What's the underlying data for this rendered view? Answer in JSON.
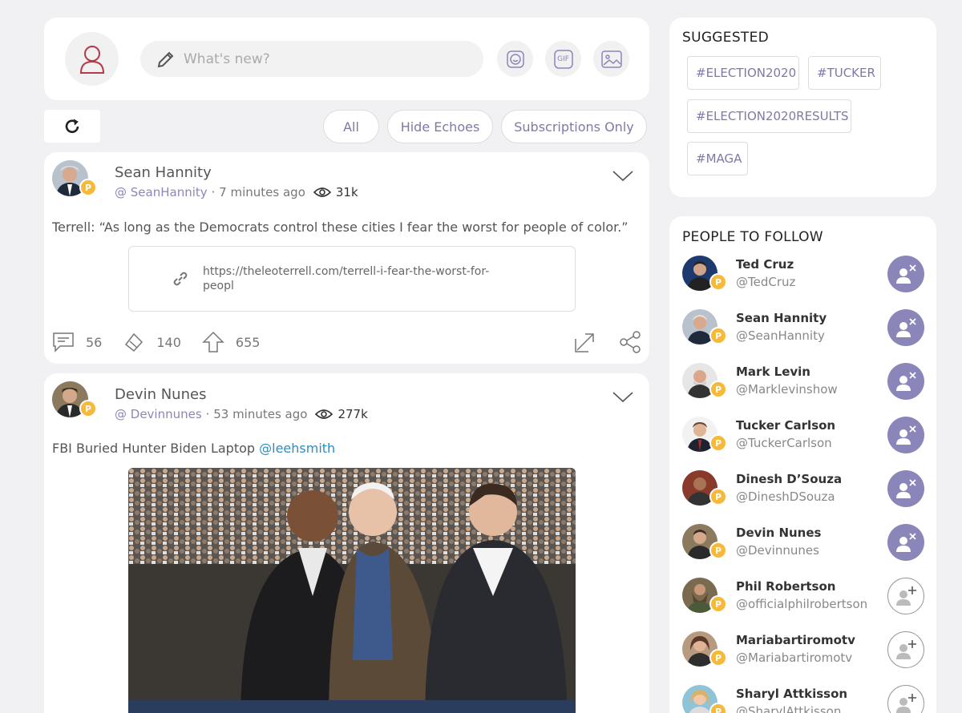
{
  "composer": {
    "placeholder": "What's new?",
    "gif_label": "GIF"
  },
  "filters": [
    "All",
    "Hide Echoes",
    "Subscriptions Only"
  ],
  "posts": [
    {
      "name": "Sean Hannity",
      "handle": "@ SeanHannity",
      "time": "· 7 minutes ago",
      "views": "31k",
      "text": "Terrell: “As long as the Democrats control these cities I fear the worst for people of color.”",
      "link_url": "https://theleoterrell.com/terrell-i-fear-the-worst-for-peopl",
      "comments": "56",
      "echoes": "140",
      "upvotes": "655"
    },
    {
      "name": "Devin Nunes",
      "handle": "@ Devinnunes",
      "time": "· 53 minutes ago",
      "views": "277k",
      "text": "FBI Buried Hunter Biden Laptop",
      "mention": "@leehsmith"
    }
  ],
  "suggested": {
    "title": "SUGGESTED",
    "tags": [
      "#ELECTION2020",
      "#TUCKER",
      "#ELECTION2020RESULTS",
      "#MAGA"
    ]
  },
  "people": {
    "title": "PEOPLE TO FOLLOW",
    "list": [
      {
        "name": "Ted Cruz",
        "handle": "@TedCruz",
        "following": true
      },
      {
        "name": "Sean Hannity",
        "handle": "@SeanHannity",
        "following": true
      },
      {
        "name": "Mark Levin",
        "handle": "@Marklevinshow",
        "following": true
      },
      {
        "name": "Tucker Carlson",
        "handle": "@TuckerCarlson",
        "following": true
      },
      {
        "name": "Dinesh D’Souza",
        "handle": "@DineshDSouza",
        "following": true
      },
      {
        "name": "Devin Nunes",
        "handle": "@Devinnunes",
        "following": true
      },
      {
        "name": "Phil Robertson",
        "handle": "@officialphilrobertson",
        "following": false
      },
      {
        "name": "Mariabartiromotv",
        "handle": "@Mariabartiromotv",
        "following": false
      },
      {
        "name": "Sharyl Attkisson",
        "handle": "@SharylAttkisson",
        "following": false
      }
    ]
  },
  "colors": {
    "accent": "#8b86b9",
    "badge": "#f6b93a",
    "link": "#2b8ec2",
    "background": "#f1f1f3"
  }
}
